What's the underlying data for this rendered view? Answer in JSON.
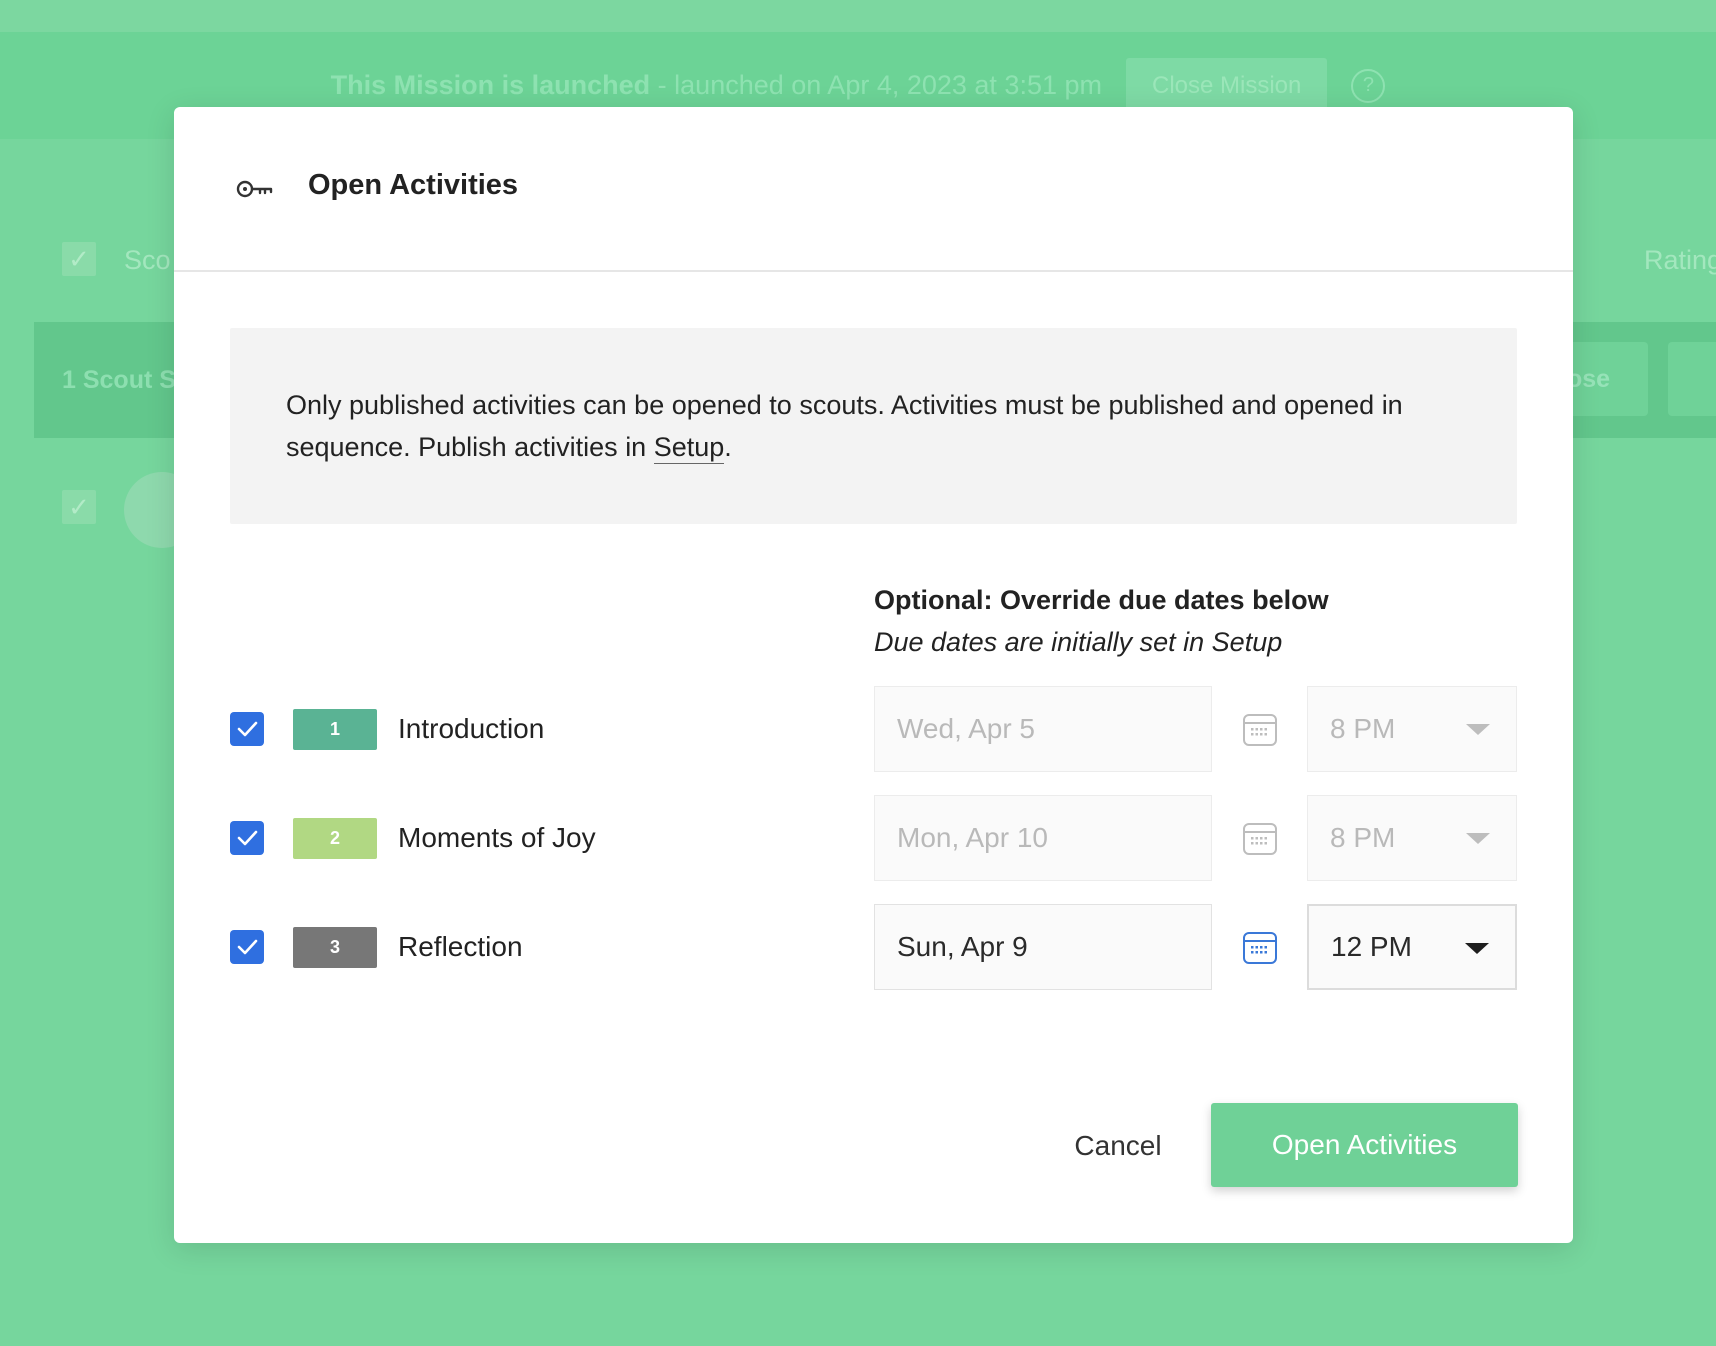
{
  "background": {
    "banner": {
      "strong_text": "This Mission is launched",
      "rest_text": "- launched on Apr 4, 2023 at 3:51 pm",
      "close_button": "Close Mission",
      "help_icon": "question-circle-icon"
    },
    "table_header_left": "Sco",
    "table_header_right": "Rating",
    "bulk_bar_label": "1 Scout S",
    "bulk_bar_button": "lose"
  },
  "modal": {
    "title": "Open Activities",
    "title_icon": "key-icon",
    "info_text_before": "Only published activities can be opened to scouts. Activities must be published and opened in sequence. Publish activities in ",
    "info_link": "Setup",
    "info_text_after": ".",
    "override_title": "Optional: Override due dates below",
    "override_subtitle": "Due dates are initially set in Setup",
    "activities": [
      {
        "number": "1",
        "name": "Introduction",
        "checked": true,
        "badge_color": "#5ab394",
        "date": "Wed, Apr 5",
        "time": "8 PM",
        "editable": false
      },
      {
        "number": "2",
        "name": "Moments of Joy",
        "checked": true,
        "badge_color": "#b1d883",
        "date": "Mon, Apr 10",
        "time": "8 PM",
        "editable": false
      },
      {
        "number": "3",
        "name": "Reflection",
        "checked": true,
        "badge_color": "#777777",
        "date": "Sun, Apr 9",
        "time": "12 PM",
        "editable": true
      }
    ],
    "cancel_label": "Cancel",
    "submit_label": "Open Activities",
    "colors": {
      "checkbox": "#2f6fe0",
      "primary_button": "#6fd197",
      "overlay": "#76d69d"
    }
  }
}
